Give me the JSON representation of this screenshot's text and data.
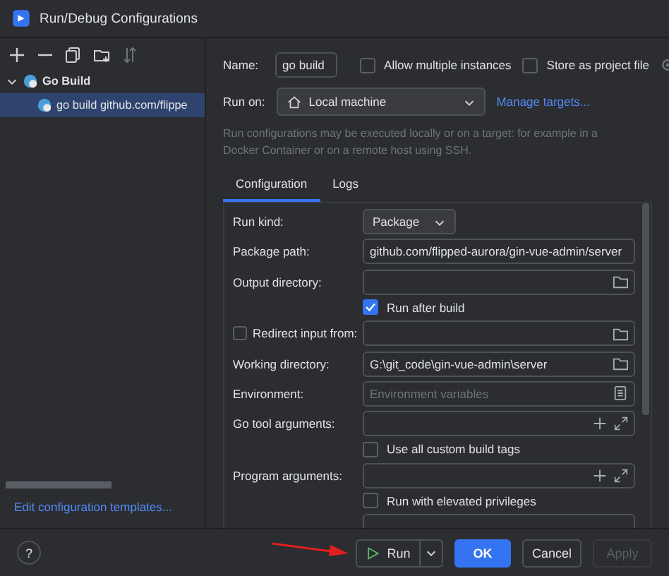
{
  "window": {
    "title": "Run/Debug Configurations"
  },
  "tree": [
    {
      "label": "Go Build",
      "expanded": true,
      "selected": false,
      "children": [
        {
          "label": "go build github.com/flippe",
          "selected": true
        }
      ]
    }
  ],
  "sidebar_link": "Edit configuration templates...",
  "name": {
    "label": "Name:",
    "value": "go build"
  },
  "options": [
    {
      "label": "Allow multiple instances",
      "checked": false
    },
    {
      "label": "Store as project file",
      "checked": false
    }
  ],
  "run_on": {
    "label": "Run on:",
    "value": "Local machine",
    "link": "Manage targets..."
  },
  "description": "Run configurations may be executed locally or on a target: for example in a Docker Container or on a remote host using SSH.",
  "tabs": [
    {
      "label": "Configuration",
      "selected": true
    },
    {
      "label": "Logs",
      "selected": false
    }
  ],
  "rows": [
    {
      "kind": "dropdown",
      "label": "Run kind:",
      "value": "Package"
    },
    {
      "kind": "text",
      "label": "Package path:",
      "value": "github.com/flipped-aurora/gin-vue-admin/server"
    },
    {
      "kind": "path",
      "label": "Output directory:"
    },
    {
      "kind": "check",
      "label": "Run after build",
      "checked": true
    },
    {
      "kind": "check-path",
      "label": "Redirect input from:",
      "checked": false
    },
    {
      "kind": "path",
      "label": "Working directory:",
      "value": "G:\\git_code\\gin-vue-admin\\server"
    },
    {
      "kind": "env",
      "label": "Environment:",
      "placeholder": "Environment variables"
    },
    {
      "kind": "args",
      "label": "Go tool arguments:"
    },
    {
      "kind": "check",
      "label": "Use all custom build tags",
      "checked": false
    },
    {
      "kind": "args",
      "label": "Program arguments:"
    },
    {
      "kind": "check",
      "label": "Run with elevated privileges",
      "checked": false
    },
    {
      "kind": "cut"
    }
  ],
  "help": "?",
  "buttons": [
    {
      "kind": "run",
      "label": "Run",
      "disabled": false
    },
    {
      "kind": "primary",
      "label": "OK",
      "disabled": false
    },
    {
      "kind": "default",
      "label": "Cancel",
      "disabled": false
    },
    {
      "kind": "default",
      "label": "Apply",
      "disabled": true
    }
  ]
}
